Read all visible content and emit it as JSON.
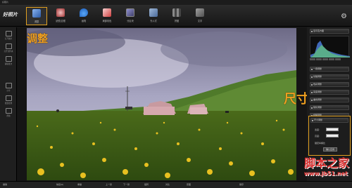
{
  "app": {
    "title": "好照片",
    "logo": "好照片"
  },
  "toolbar": {
    "tools": [
      {
        "label": "调整",
        "icon": "adjust-icon",
        "color": "#5a8ed8",
        "active": true
      },
      {
        "label": "滤镜/边框",
        "icon": "filter-icon",
        "color": "#c05050"
      },
      {
        "label": "画笔",
        "icon": "brush-icon",
        "color": "#2a7ad8"
      },
      {
        "label": "局部彩色",
        "icon": "partial-color-icon",
        "color": "#d04040"
      },
      {
        "label": "分区块",
        "icon": "region-icon",
        "color": "#6060a0"
      },
      {
        "label": "光斗式",
        "icon": "light-icon",
        "color": "#4a6a9a"
      },
      {
        "label": "拼图",
        "icon": "collage-icon",
        "color": "#6a6a6a"
      },
      {
        "label": "文字",
        "icon": "text-icon",
        "color": "#707070"
      }
    ]
  },
  "left_sidebar": {
    "items": [
      {
        "label": "打开图片",
        "icon": "open-icon"
      },
      {
        "label": "打开文件夹",
        "icon": "folder-icon"
      },
      {
        "label": "编辑批次",
        "icon": "edit-icon"
      },
      {
        "label": "分享",
        "icon": "share-icon"
      },
      {
        "label": "批量处理",
        "icon": "batch-icon"
      },
      {
        "label": "帮助",
        "icon": "help-icon"
      }
    ]
  },
  "annotations": {
    "top_left": "调整",
    "right": "尺寸调整"
  },
  "right_panel": {
    "histogram_title": "显示直方图",
    "buttons": [
      "一键调整",
      "基础调整",
      "色彩调整",
      "亮度调整",
      "曲线调整",
      "锐化调整",
      "模糊调整",
      "尺寸调整"
    ],
    "size_box": {
      "title": "尺寸调整",
      "width_label": "宽度:",
      "height_label": "高度:",
      "keep_ratio": "锁定纵横比",
      "apply": "确认应用"
    }
  },
  "bottom_bar": {
    "items": [
      "撤销",
      "恢复(0)",
      "重做",
      "上一张",
      "下一张",
      "旋转",
      "对比",
      "原图",
      "保存"
    ]
  },
  "watermark": {
    "text": "脚本之家",
    "url": "www.jb51.net"
  }
}
